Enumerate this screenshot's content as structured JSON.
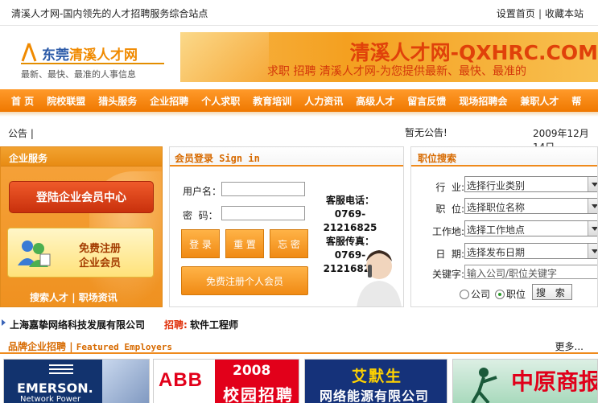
{
  "topbar": {
    "slogan": "清溪人才网-国内领先的人才招聘服务综合站点",
    "set_home": "设置首页",
    "sep": "|",
    "favorite": "收藏本站"
  },
  "logo": {
    "name_a": "东莞",
    "name_b": "清溪人才网",
    "tagline": "最新、最快、最准的人事信息"
  },
  "banner": {
    "headline": "清溪人才网-QXHRC.COM",
    "sub": "求职 招聘 清溪人才网-为您提供最新、最快、最准的"
  },
  "nav": {
    "items": [
      "首 页",
      "院校联盟",
      "猎头服务",
      "企业招聘",
      "个人求职",
      "教育培训",
      "人力资讯",
      "高级人才",
      "留言反馈",
      "现场招聘会",
      "兼职人才",
      "帮"
    ]
  },
  "notice": {
    "label": "公告 |",
    "content": "暂无公告!",
    "date": "2009年12月14日"
  },
  "enterprise": {
    "title": "企业服务",
    "login": "登陆企业会员中心",
    "reg_line1": "免费注册",
    "reg_line2": "企业会员",
    "link_talent": "搜索人才",
    "link_sep": "|",
    "link_news": "职场资讯"
  },
  "member": {
    "title": "会员登录 Sign in",
    "user_label": "用户名：",
    "pass_label": "密  码：",
    "btn_login": "登 录",
    "btn_reset": "重 置",
    "btn_forgot": "忘 密",
    "btn_register": "免费注册个人会员",
    "phone_label": "客服电话：",
    "phone_a": "0769-",
    "phone_b": "21216825",
    "fax_label": "客服传真：",
    "fax_a": "0769-",
    "fax_b": "21216825"
  },
  "search": {
    "title": "职位搜索",
    "industry_label": "行  业:",
    "industry_value": "选择行业类别",
    "position_label": "职  位:",
    "position_value": "选择职位名称",
    "location_label": "工作地:",
    "location_value": "选择工作地点",
    "date_label": "日  期:",
    "date_value": "选择发布日期",
    "keyword_label": "关键字:",
    "keyword_placeholder": "输入公司/职位关键字",
    "radio_company": "公司",
    "radio_job": "职位",
    "btn_search": "搜 索"
  },
  "ticker": {
    "company": "上海嘉挚网络科技发展有限公司",
    "recruit": "招聘:",
    "job": "软件工程师"
  },
  "featured": {
    "title_cn": "品牌企业招聘",
    "sep": "|",
    "title_en": "Featured Employers",
    "more": "更多..."
  },
  "logos": {
    "emerson_name": "EMERSON.",
    "emerson_sub": "Network Power",
    "abb_name": "ABB",
    "abb_year": "2008",
    "abb_text": "校园招聘",
    "ems_name": "艾默生",
    "ems_sub": "网络能源有限公司",
    "zy_name": "中原商报"
  },
  "colors": {
    "nav_orange": "#ef7800",
    "accent": "#d76a00",
    "brand_blue": "#2b5aa8"
  }
}
